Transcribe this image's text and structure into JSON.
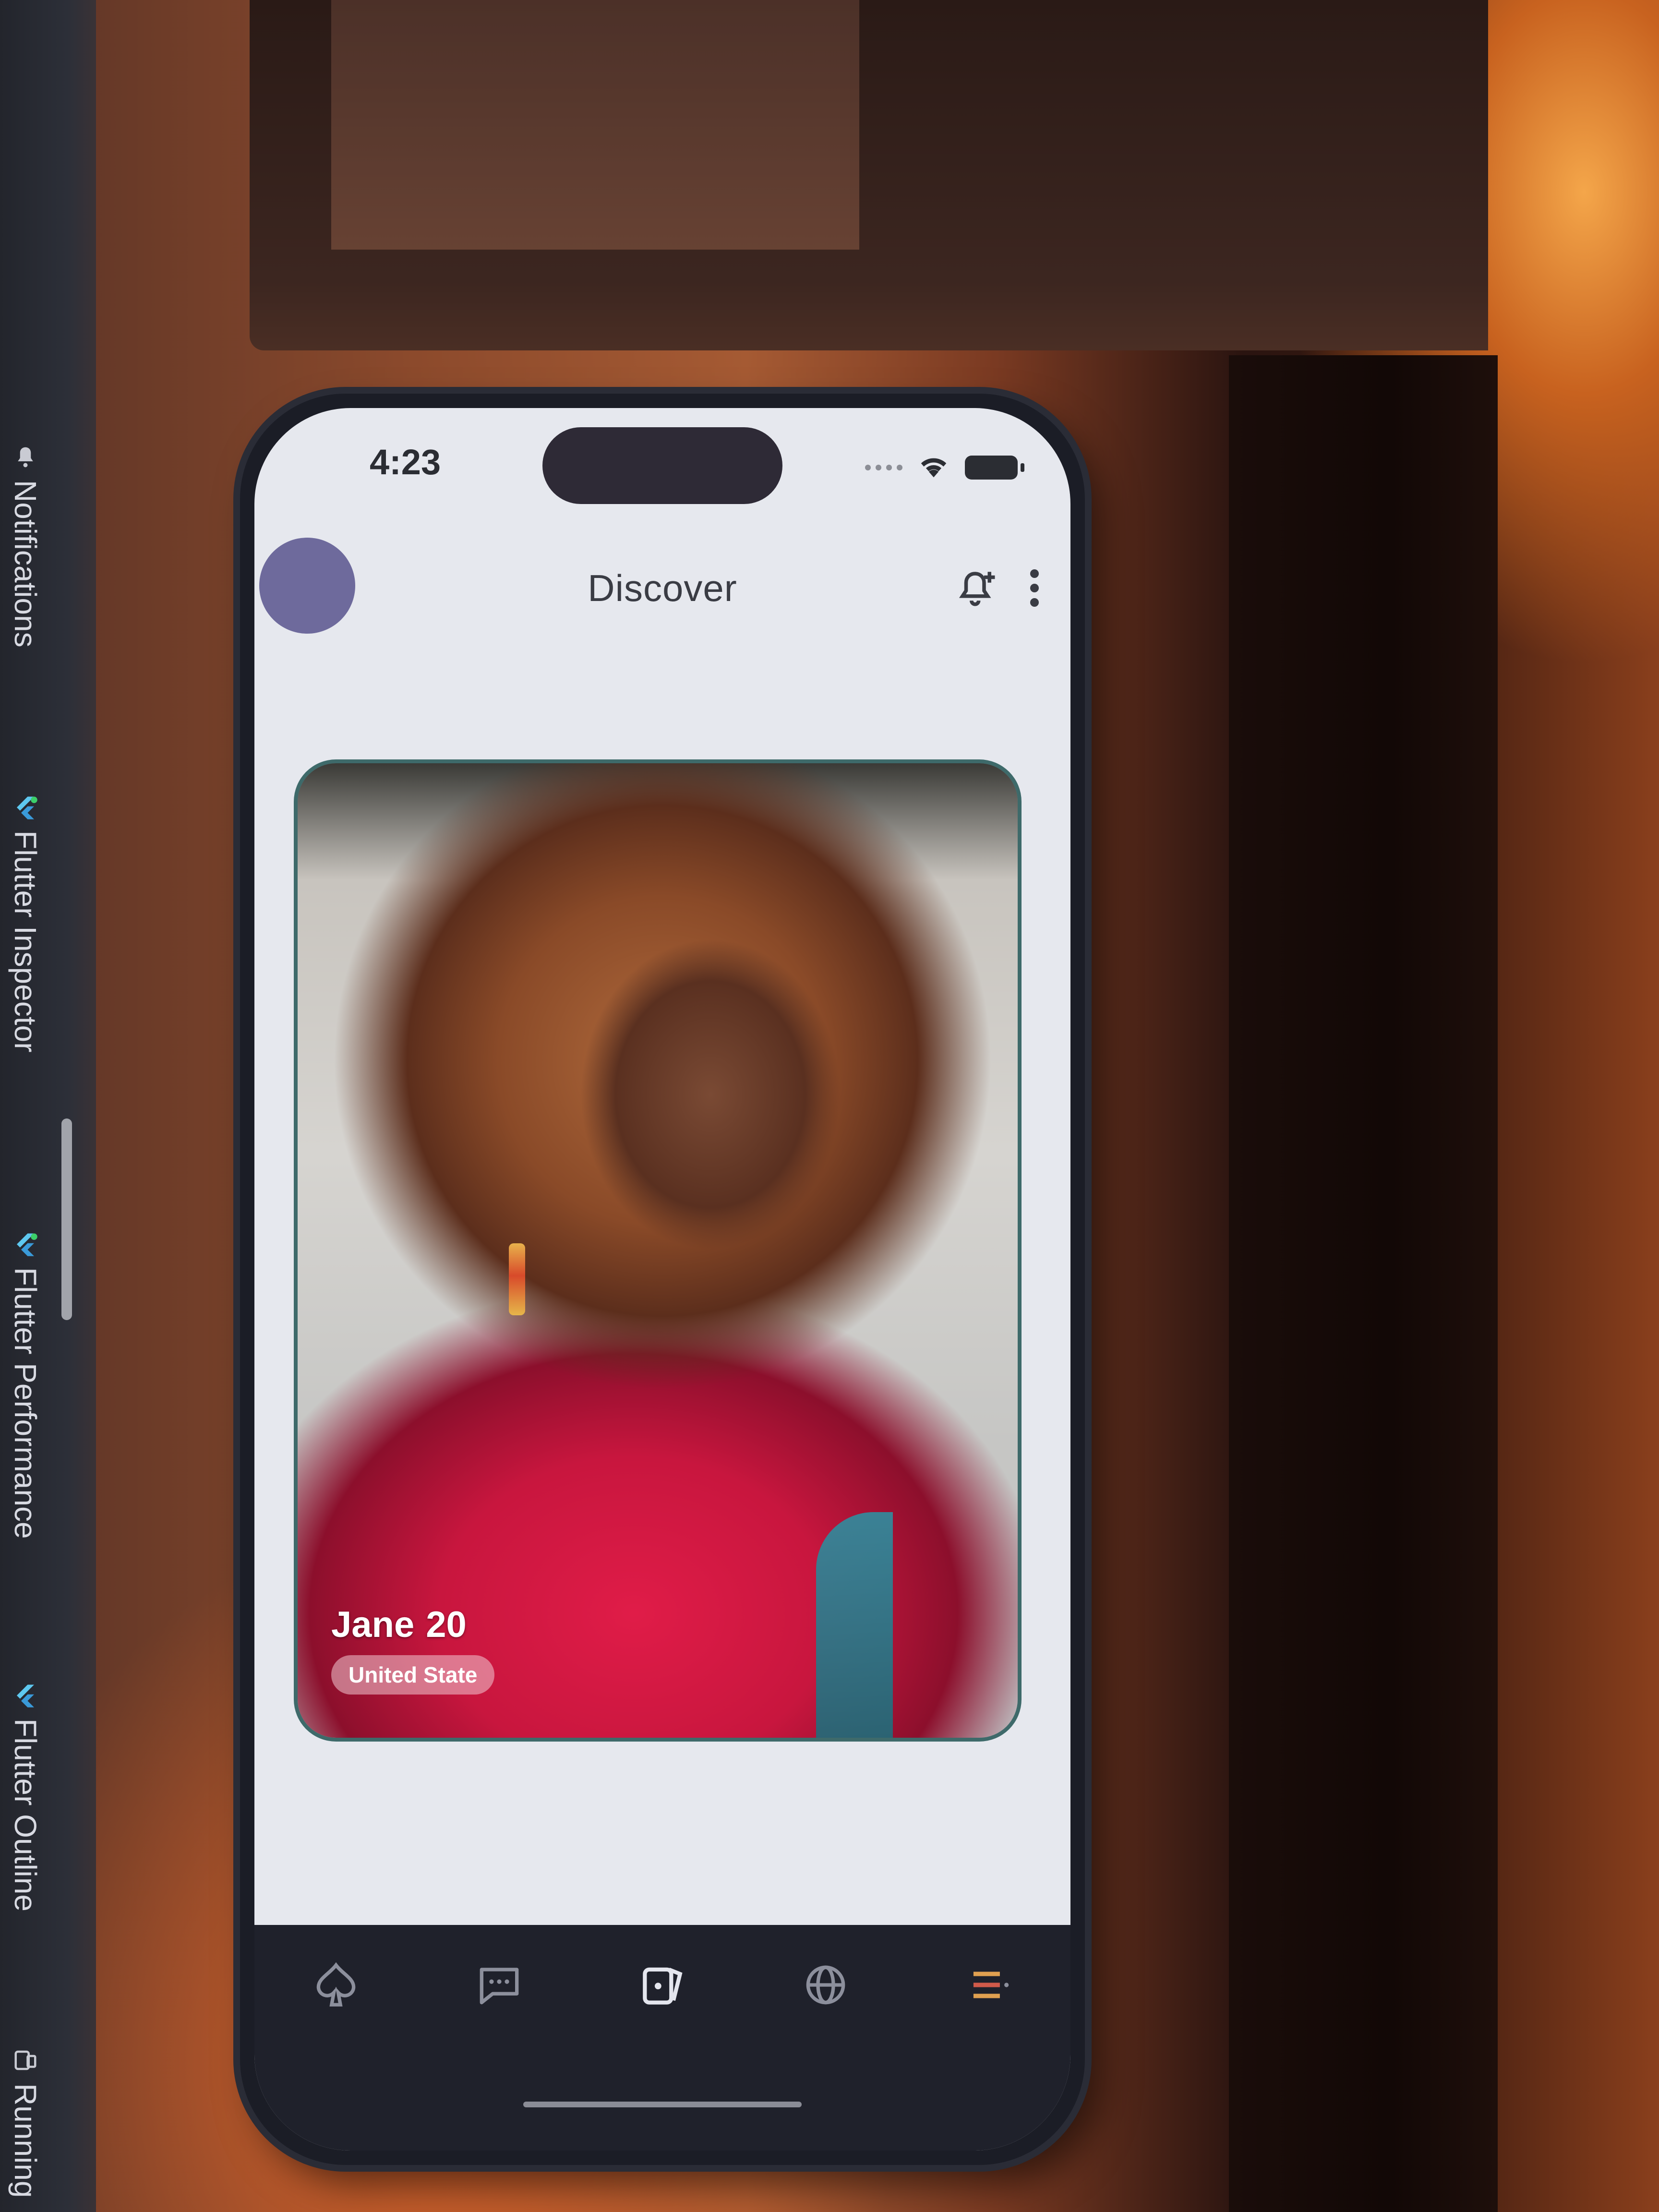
{
  "ide_panel": {
    "tabs": [
      {
        "label": "Notifications",
        "icon": "bell-icon"
      },
      {
        "label": "Flutter Inspector",
        "icon": "flutter-icon"
      },
      {
        "label": "Flutter Performance",
        "icon": "flutter-icon"
      },
      {
        "label": "Flutter Outline",
        "icon": "flutter-icon"
      },
      {
        "label": "Running",
        "icon": "device-icon"
      }
    ]
  },
  "status_bar": {
    "time": "4:23",
    "icons": [
      "signal-icon",
      "wifi-icon",
      "battery-icon"
    ]
  },
  "app_bar": {
    "title": "Discover",
    "avatar_color": "#6e6a9c",
    "actions": [
      "notification-add-icon",
      "more-vert-icon"
    ]
  },
  "profile_card": {
    "name": "Jane",
    "age": "20",
    "country": "United State"
  },
  "bottom_nav": {
    "items": [
      {
        "icon": "spade-icon",
        "active": false
      },
      {
        "icon": "chat-icon",
        "active": false
      },
      {
        "icon": "cards-icon",
        "active": true
      },
      {
        "icon": "globe-icon",
        "active": false
      },
      {
        "icon": "menu-icon",
        "active": false
      }
    ]
  },
  "colors": {
    "screen_bg": "#e6e8ee",
    "nav_bg": "#1f212b",
    "accent": "#6e6a9c"
  }
}
